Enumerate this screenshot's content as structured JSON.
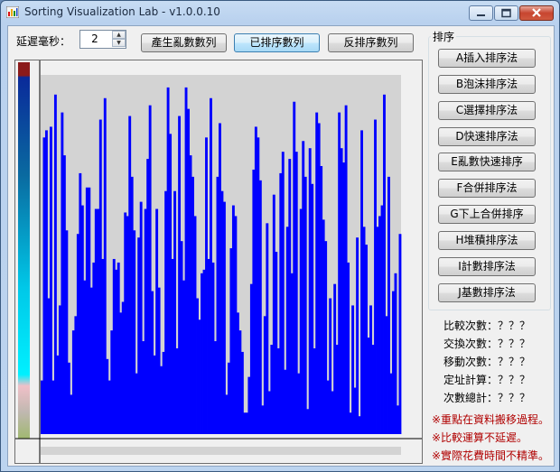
{
  "window": {
    "title": "Sorting Visualization Lab - v1.0.0.10"
  },
  "delay": {
    "label": "延遲毫秒：",
    "value": "2"
  },
  "toolbar": {
    "random_label": "產生亂數數列",
    "sorted_label": "已排序數列",
    "reverse_label": "反排序數列"
  },
  "sort_group": {
    "title": "排序",
    "buttons": [
      {
        "label": "A插入排序法"
      },
      {
        "label": "B泡沫排序法"
      },
      {
        "label": "C選擇排序法"
      },
      {
        "label": "D快速排序法"
      },
      {
        "label": "E亂數快速排序"
      },
      {
        "label": "F合併排序法"
      },
      {
        "label": "G下上合併排序"
      },
      {
        "label": "H堆積排序法"
      },
      {
        "label": "I計數排序法"
      },
      {
        "label": "J基數排序法"
      }
    ]
  },
  "stats": [
    {
      "label": "比較次數：？？？"
    },
    {
      "label": "交換次數：？？？"
    },
    {
      "label": "移動次數：？？？"
    },
    {
      "label": "定址計算：？？？"
    },
    {
      "label": "次數總計：？？？"
    }
  ],
  "notes": [
    {
      "text": "※重點在資料搬移過程。"
    },
    {
      "text": "※比較運算不延遲。"
    },
    {
      "text": "※實際花費時間不精準。"
    }
  ],
  "colors": {
    "bar": "#0000ff",
    "plot_bg": "#d3d3d3",
    "note": "#b00000"
  },
  "bars": {
    "max": 100,
    "values": [
      15,
      83,
      85,
      38,
      86,
      15,
      95,
      22,
      36,
      90,
      78,
      57,
      20,
      11,
      29,
      33,
      56,
      73,
      64,
      43,
      69,
      69,
      41,
      48,
      63,
      63,
      88,
      49,
      94,
      21,
      15,
      29,
      49,
      46,
      48,
      34,
      37,
      62,
      61,
      89,
      72,
      57,
      17,
      55,
      65,
      26,
      63,
      77,
      92,
      40,
      22,
      63,
      41,
      19,
      23,
      68,
      97,
      84,
      49,
      68,
      24,
      89,
      54,
      43,
      97,
      91,
      78,
      72,
      61,
      38,
      32,
      45,
      46,
      83,
      49,
      94,
      48,
      26,
      72,
      87,
      68,
      65,
      11,
      20,
      52,
      64,
      61,
      34,
      29,
      23,
      6,
      6,
      16,
      42,
      74,
      86,
      83,
      71,
      8,
      33,
      59,
      12,
      25,
      67,
      51,
      24,
      73,
      79,
      18,
      58,
      77,
      45,
      93,
      79,
      17,
      63,
      82,
      72,
      7,
      80,
      70,
      24,
      90,
      87,
      75,
      60,
      54,
      15,
      38,
      12,
      42,
      25,
      90,
      80,
      76,
      92,
      48,
      6,
      36,
      13,
      55,
      5,
      85,
      58,
      53,
      27,
      36,
      25,
      88,
      58,
      61,
      64,
      95,
      33,
      72,
      17,
      40,
      45,
      8,
      56
    ]
  }
}
